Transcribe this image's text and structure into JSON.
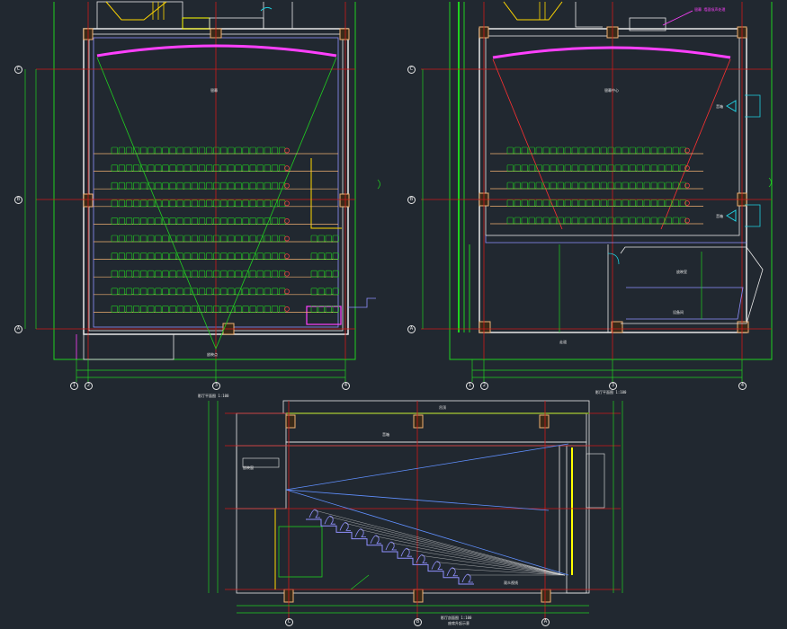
{
  "colors": {
    "background": "#212830",
    "wall": "#e8e8e8",
    "grid_axis": "#d01818",
    "dimension": "#20d020",
    "seat": "#20d020",
    "screen": "#ff40ff",
    "row_line": "#f0b070",
    "stair": "#ffd700",
    "sightline_blue": "#6090ff",
    "sightline_red": "#ff3030",
    "interior": "#9090ff",
    "cyan": "#20d0e0",
    "yellow": "#ffff00"
  },
  "plan_left": {
    "title": "影厅平面图 1:100",
    "axis_letters": [
      "C",
      "B",
      "A"
    ],
    "axis_numbers": [
      "1",
      "2",
      "3",
      "4"
    ],
    "screen_label": "银幕",
    "projector_label": "放映点"
  },
  "plan_right": {
    "title": "影厅平面图 1:100",
    "axis_letters": [
      "C",
      "B",
      "A"
    ],
    "axis_numbers": [
      "1",
      "2",
      "3",
      "4"
    ],
    "callout_label": "银幕 墙面吸声处理",
    "screen_label": "银幕中心",
    "speaker_labels": [
      "音箱",
      "音箱"
    ],
    "room_labels": [
      "放映室",
      "设备间",
      "走道"
    ]
  },
  "section": {
    "title": "影厅剖面图 1:100",
    "subtitle": "座席升起示意",
    "axis_letters": [
      "C",
      "B",
      "A"
    ],
    "ceiling_label": "吊顶",
    "projection_label": "放映窗",
    "speaker_label": "音箱",
    "note_label": "观众视线"
  }
}
